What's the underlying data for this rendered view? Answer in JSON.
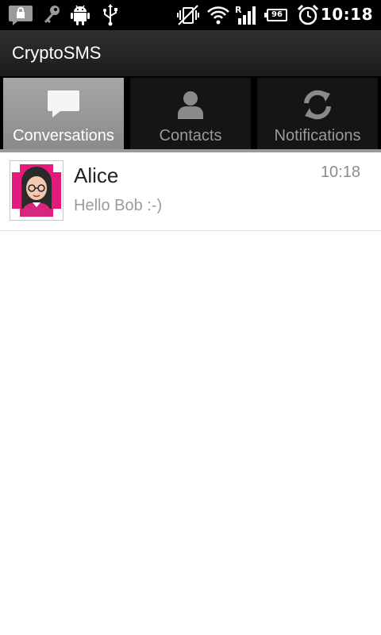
{
  "status_bar": {
    "time": "10:18",
    "battery_level": "96",
    "signal_label": "R",
    "icons": [
      "lock-notification-icon",
      "key-icon",
      "android-debug-icon",
      "usb-icon",
      "vibrate-off-icon",
      "wifi-icon",
      "signal-icon",
      "battery-icon",
      "alarm-icon"
    ]
  },
  "app": {
    "title": "CryptoSMS"
  },
  "tabs": [
    {
      "label": "Conversations",
      "icon": "chat-bubble-icon",
      "selected": true
    },
    {
      "label": "Contacts",
      "icon": "person-icon",
      "selected": false
    },
    {
      "label": "Notifications",
      "icon": "sync-icon",
      "selected": false
    }
  ],
  "conversations": [
    {
      "name": "Alice",
      "time": "10:18",
      "preview": "Hello Bob :-)",
      "avatar": "cartoon-woman-avatar"
    }
  ],
  "colors": {
    "tab_selected": "#9a9a9a",
    "tab_unselected": "#151515",
    "text_primary": "#222222",
    "text_secondary": "#9b9b9b"
  }
}
